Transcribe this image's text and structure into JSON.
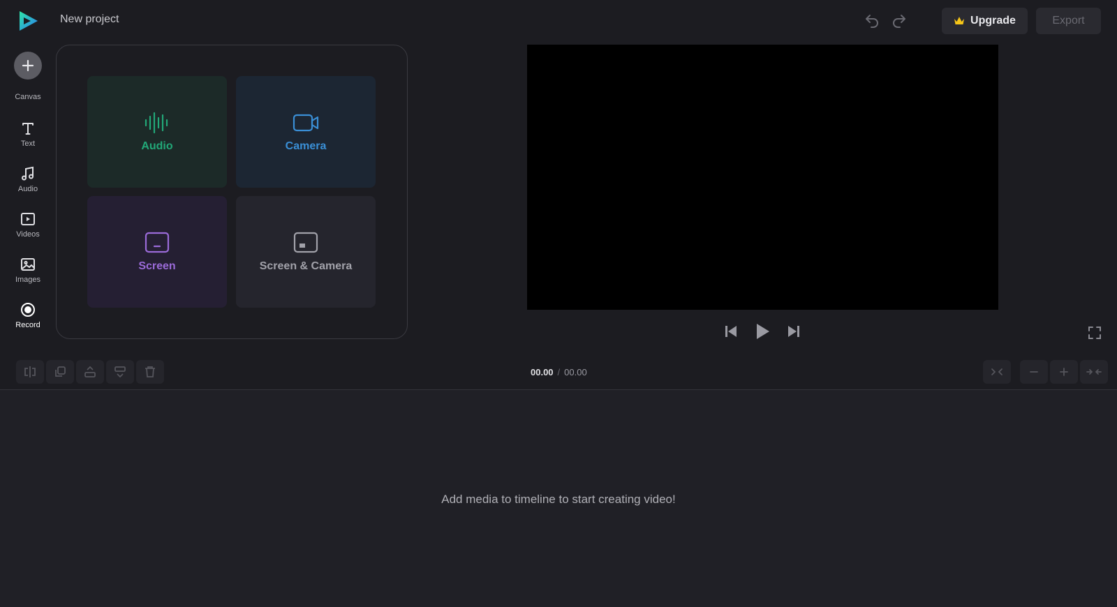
{
  "header": {
    "project_title": "New project",
    "upgrade_label": "Upgrade",
    "export_label": "Export"
  },
  "sidebar": {
    "items": [
      {
        "label": "Canvas",
        "icon": "plus-icon"
      },
      {
        "label": "Text",
        "icon": "text-icon"
      },
      {
        "label": "Audio",
        "icon": "music-note-icon"
      },
      {
        "label": "Videos",
        "icon": "video-icon"
      },
      {
        "label": "Images",
        "icon": "image-icon"
      },
      {
        "label": "Record",
        "icon": "record-icon"
      }
    ]
  },
  "record_panel": {
    "options": [
      {
        "label": "Audio",
        "icon": "waveform-icon",
        "color": "#22a878"
      },
      {
        "label": "Camera",
        "icon": "camera-icon",
        "color": "#3a8fd6"
      },
      {
        "label": "Screen",
        "icon": "screen-icon",
        "color": "#9b6bd9"
      },
      {
        "label": "Screen & Camera",
        "icon": "screen-camera-icon",
        "color": "#a2a2aa"
      }
    ]
  },
  "timeline": {
    "current_time": "00.00",
    "separator": "/",
    "total_time": "00.00",
    "empty_message": "Add media to timeline to start creating video!"
  },
  "colors": {
    "background": "#1c1c21",
    "preview": "#000000",
    "accent_crown": "#f5c518"
  }
}
